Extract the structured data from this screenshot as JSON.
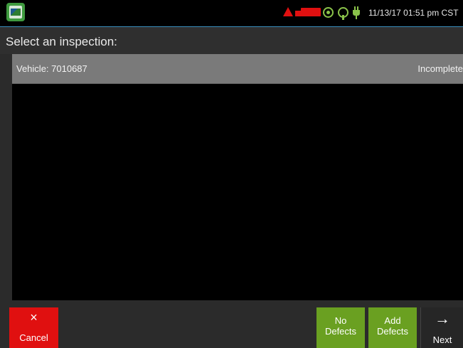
{
  "status_bar": {
    "datetime": "11/13/17 01:51 pm CST",
    "icons": [
      "app-logo-icon",
      "alert-icon",
      "truck-icon",
      "gps-icon",
      "signal-icon",
      "plug-icon"
    ],
    "alert_color": "#e01010",
    "ok_color": "#8bc34a"
  },
  "header": {
    "title": "Select an inspection:"
  },
  "inspections": [
    {
      "label": "Vehicle: 7010687",
      "status": "Incomplete"
    }
  ],
  "footer": {
    "cancel": {
      "icon": "close-icon",
      "glyph": "×",
      "label": "Cancel"
    },
    "no_defects": {
      "line1": "No",
      "line2": "Defects"
    },
    "add_defects": {
      "line1": "Add",
      "line2": "Defects"
    },
    "next": {
      "icon": "arrow-right-icon",
      "glyph": "→",
      "label": "Next"
    }
  },
  "colors": {
    "accent_line": "#3a8fbf",
    "cancel_red": "#e01010",
    "action_green": "#6aa021",
    "selected_row": "#7a7a7a"
  }
}
